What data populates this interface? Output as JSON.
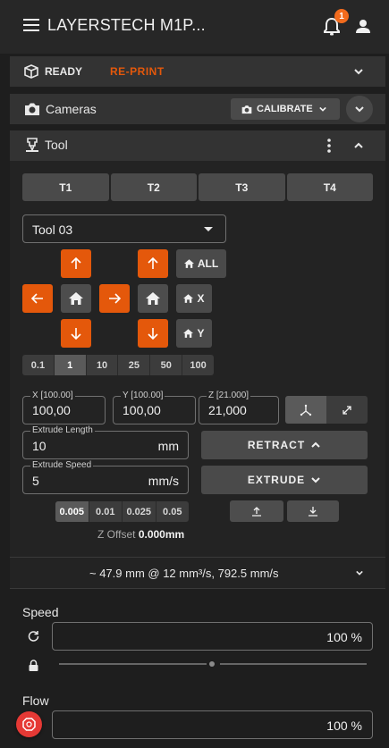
{
  "app": {
    "title": "LAYERSTECH M1P...",
    "notification_count": "1"
  },
  "status": {
    "state": "READY",
    "reprint_label": "RE-PRINT",
    "accent": "#e4580b"
  },
  "cameras": {
    "title": "Cameras",
    "calibrate_label": "CALIBRATE"
  },
  "tool": {
    "title": "Tool",
    "tools": [
      "T1",
      "T2",
      "T3",
      "T4"
    ],
    "selected_tool": "Tool 03",
    "home_all_label": "ALL",
    "home_x_label": "X",
    "home_y_label": "Y",
    "steps": [
      "0.1",
      "1",
      "10",
      "25",
      "50",
      "100"
    ],
    "active_step": "1",
    "x_label": "X [100.00]",
    "x_value": "100,00",
    "y_label": "Y [100.00]",
    "y_value": "100,00",
    "z_label": "Z [21.000]",
    "z_value": "21,000",
    "extrude_length_label": "Extrude Length",
    "extrude_length_value": "10",
    "extrude_length_unit": "mm",
    "extrude_speed_label": "Extrude Speed",
    "extrude_speed_value": "5",
    "extrude_speed_unit": "mm/s",
    "retract_label": "RETRACT",
    "extrude_label": "EXTRUDE",
    "z_steps": [
      "0.005",
      "0.01",
      "0.025",
      "0.05"
    ],
    "active_z_step": "0.005",
    "z_offset_label": "Z Offset",
    "z_offset_value": "0.000mm",
    "flow_summary": "~ 47.9 mm @ 12 mm³/s, 792.5 mm/s"
  },
  "speed": {
    "label": "Speed",
    "value": "100 %"
  },
  "flow": {
    "label": "Flow",
    "value": "100 %"
  },
  "colors": {
    "background": "#1e1e1e",
    "panel": "#333333",
    "orange": "#e4580b",
    "badge": "#f26b1d",
    "fab": "#e53935"
  }
}
